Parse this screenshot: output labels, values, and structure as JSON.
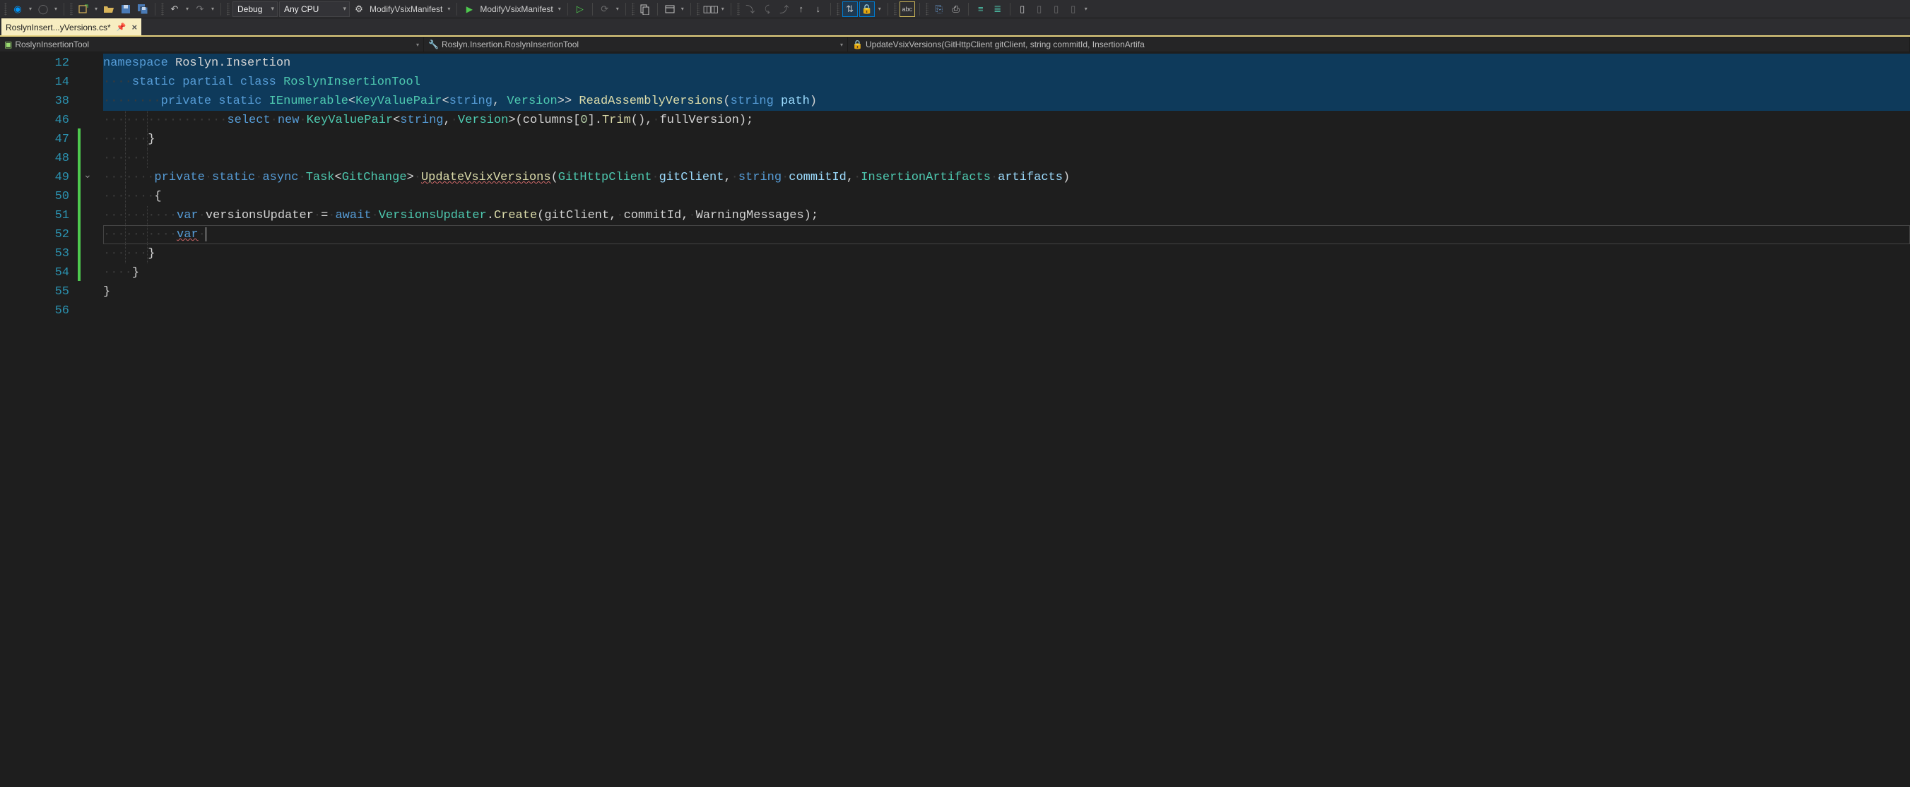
{
  "toolbar": {
    "config_debug": "Debug",
    "config_platform": "Any CPU",
    "startup1": "ModifyVsixManifest",
    "startup2": "ModifyVsixManifest"
  },
  "tab": {
    "title": "RoslynInsert...yVersions.cs*"
  },
  "nav": {
    "scope": "RoslynInsertionTool",
    "type": "Roslyn.Insertion.RoslynInsertionTool",
    "member": "UpdateVsixVersions(GitHttpClient gitClient, string commitId, InsertionArtifa"
  },
  "lines": {
    "numbers": [
      "12",
      "14",
      "38",
      "46",
      "47",
      "48",
      "49",
      "50",
      "51",
      "52",
      "53",
      "54",
      "55",
      "56"
    ],
    "l12": {
      "kw1": "namespace",
      "ns": "Roslyn.Insertion"
    },
    "l14": {
      "kw1": "static",
      "kw2": "partial",
      "kw3": "class",
      "cls": "RoslynInsertionTool"
    },
    "l38": {
      "kw1": "private",
      "kw2": "static",
      "ret": "IEnumerable",
      "kv": "KeyValuePair",
      "s": "string",
      "v": "Version",
      "m": "ReadAssemblyVersions",
      "p": "path"
    },
    "l46": {
      "kw": "select",
      "kw2": "new",
      "kv": "KeyValuePair",
      "s": "string",
      "v": "Version",
      "col": "columns",
      "idx": "0",
      "trim": "Trim",
      "fv": "fullVersion"
    },
    "l47": {
      "brace": "}"
    },
    "l49": {
      "kw1": "private",
      "kw2": "static",
      "kw3": "async",
      "task": "Task",
      "gc": "GitChange",
      "m": "UpdateVsixVersions",
      "t1": "GitHttpClient",
      "p1": "gitClient",
      "t2": "string",
      "p2": "commitId",
      "t3": "InsertionArtifacts",
      "p3": "artifacts"
    },
    "l50": {
      "brace": "{"
    },
    "l51": {
      "kw": "var",
      "v": "versionsUpdater",
      "eq": "=",
      "aw": "await",
      "cls": "VersionsUpdater",
      "m": "Create",
      "a1": "gitClient",
      "a2": "commitId",
      "a3": "WarningMessages"
    },
    "l52": {
      "kw": "var"
    },
    "l53": {
      "brace": "}"
    },
    "l54": {
      "brace": "}"
    },
    "l55": {
      "brace": "}"
    }
  }
}
